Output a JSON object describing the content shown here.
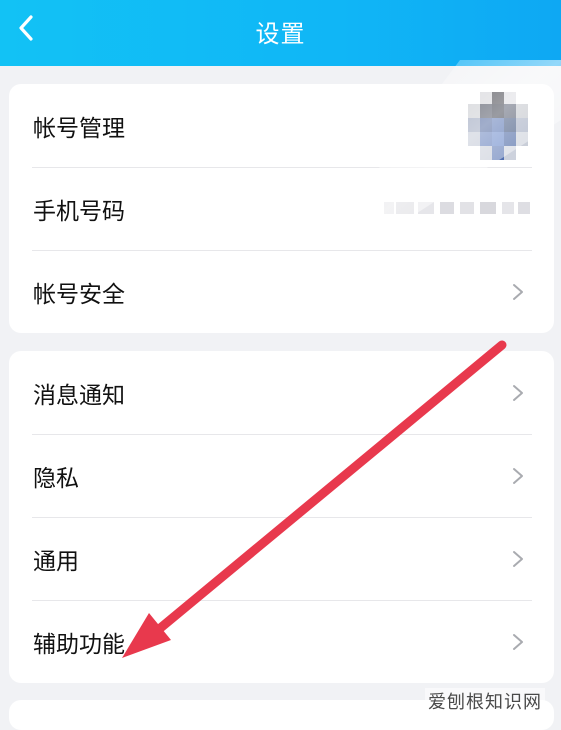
{
  "header": {
    "title": "设置",
    "back_icon": "chevron-left-icon"
  },
  "account_section": {
    "items": [
      {
        "label": "帐号管理",
        "trailing": "avatar"
      },
      {
        "label": "手机号码",
        "trailing": "phone-number"
      },
      {
        "label": "帐号安全",
        "trailing": "chevron-right-icon"
      }
    ]
  },
  "general_section": {
    "items": [
      {
        "label": "消息通知",
        "trailing": "chevron-right-icon"
      },
      {
        "label": "隐私",
        "trailing": "chevron-right-icon"
      },
      {
        "label": "通用",
        "trailing": "chevron-right-icon"
      },
      {
        "label": "辅助功能",
        "trailing": "chevron-right-icon"
      }
    ]
  },
  "annotation": {
    "type": "red-arrow",
    "color": "#e8394d"
  },
  "watermark": "爱刨根知识网",
  "colors": {
    "header": "#12c2f5",
    "background": "#f1f2f5",
    "card": "#ffffff",
    "chevron": "#a9abb0"
  }
}
